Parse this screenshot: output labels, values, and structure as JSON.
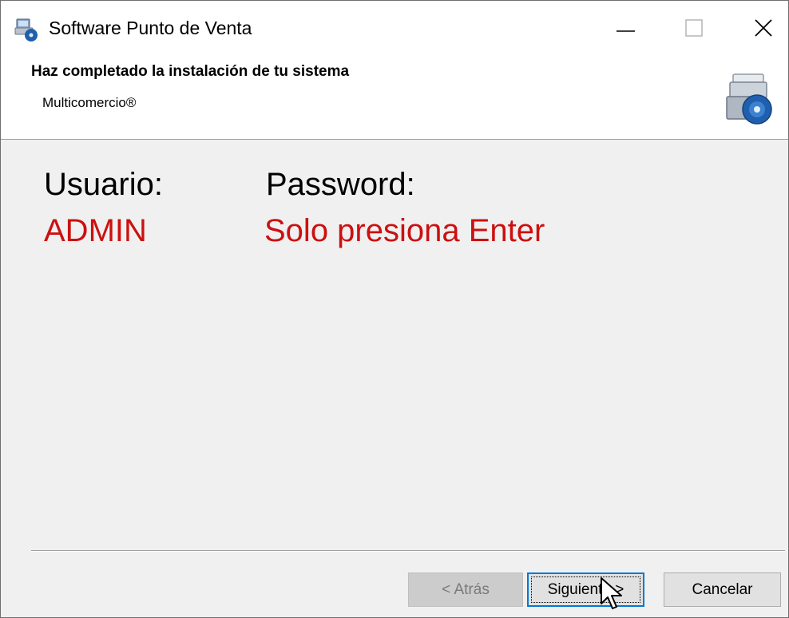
{
  "window": {
    "title": "Software Punto de Venta",
    "icons": {
      "app": "installer-app-icon",
      "minimize": "minimize-icon",
      "maximize": "maximize-icon",
      "close": "close-icon"
    }
  },
  "header": {
    "title": "Haz completado la instalación de tu sistema",
    "subtitle": "Multicomercio®",
    "icon": "setup-disc-icon"
  },
  "content": {
    "user_label": "Usuario:",
    "user_value": "ADMIN",
    "password_label": "Password:",
    "password_value": "Solo presiona Enter",
    "value_color": "#cc1010"
  },
  "buttons": {
    "back": "< Atrás",
    "next": "Siguiente >",
    "cancel": "Cancelar"
  },
  "cursor": {
    "icon": "mouse-pointer-icon"
  }
}
